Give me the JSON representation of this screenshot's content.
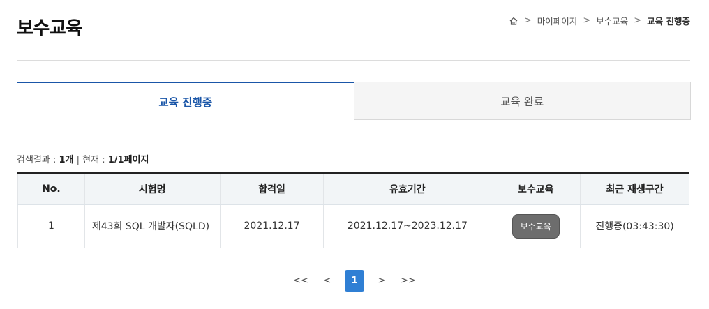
{
  "page": {
    "title": "보수교육"
  },
  "breadcrumb": {
    "home_icon": "home-icon",
    "items": [
      "마이페이지",
      "보수교육",
      "교육 진행중"
    ],
    "sep": ">"
  },
  "tabs": [
    {
      "label": "교육 진행중",
      "active": true
    },
    {
      "label": "교육 완료",
      "active": false
    }
  ],
  "result": {
    "prefix": "검색결과 : ",
    "count": "1개",
    "divider": " | ",
    "current_label": "현재 : ",
    "page": "1/1페이지"
  },
  "table": {
    "headers": [
      "No.",
      "시험명",
      "합격일",
      "유효기간",
      "보수교육",
      "최근 재생구간"
    ],
    "rows": [
      {
        "no": "1",
        "exam": "제43회 SQL 개발자(SQLD)",
        "pass_date": "2021.12.17",
        "valid": "2021.12.17~2023.12.17",
        "button": "보수교육",
        "recent": "진행중(03:43:30)"
      }
    ]
  },
  "pagination": {
    "first": "<<",
    "prev": "<",
    "current": "1",
    "next": ">",
    "last": ">>"
  },
  "colors": {
    "accent": "#1a56a8",
    "page_active": "#2f7fd4",
    "button_bg": "#6d6d6d"
  }
}
